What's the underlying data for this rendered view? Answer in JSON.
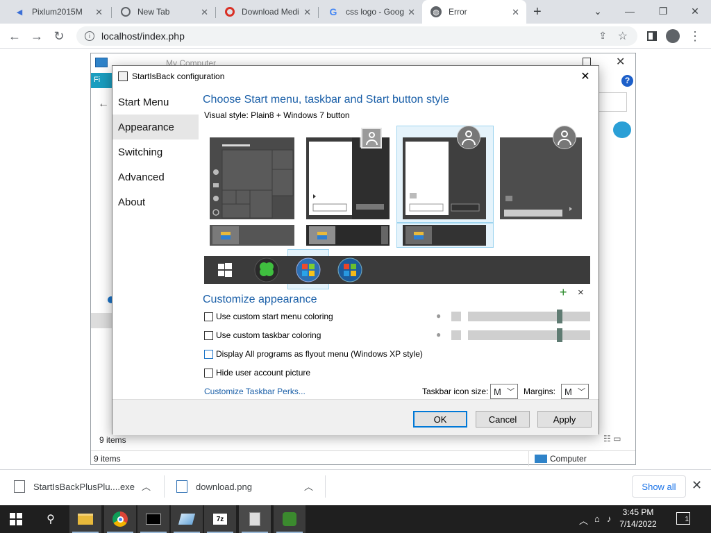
{
  "browser": {
    "tabs": [
      {
        "title": "Pixlum2015M",
        "active": false
      },
      {
        "title": "New Tab",
        "active": false
      },
      {
        "title": "Download Medi",
        "active": false
      },
      {
        "title": "css logo - Goog",
        "active": false
      },
      {
        "title": "Error",
        "active": true
      }
    ],
    "new_tab_symbol": "+",
    "url": "localhost/index.php"
  },
  "explorer": {
    "title": "My Computer",
    "ribbon_tab": "Fi",
    "items_count_top": "9 items",
    "items_count_status": "9 items",
    "status_location": "Computer"
  },
  "dialog": {
    "title": "StartIsBack configuration",
    "nav": [
      {
        "label": "Start Menu",
        "selected": false
      },
      {
        "label": "Appearance",
        "selected": true
      },
      {
        "label": "Switching",
        "selected": false
      },
      {
        "label": "Advanced",
        "selected": false
      },
      {
        "label": "About",
        "selected": false
      }
    ],
    "heading_style": "Choose Start menu, taskbar and Start button style",
    "visual_style": "Visual style:  Plain8 + Windows 7 button",
    "heading_customize": "Customize appearance",
    "options": [
      {
        "label": "Use custom start menu coloring",
        "checked": false
      },
      {
        "label": "Use custom taskbar coloring",
        "checked": false
      },
      {
        "label": "Display All programs as flyout menu (Windows XP style)",
        "checked": false
      },
      {
        "label": "Hide user account picture",
        "checked": false
      }
    ],
    "start_menu_slider_level": 0.76,
    "taskbar_slider_level": 0.76,
    "add_symbol": "+",
    "remove_symbol": "×",
    "perks_link": "Customize Taskbar Perks...",
    "taskbar_icon_size_label": "Taskbar icon size:",
    "taskbar_icon_size_value": "M",
    "margins_label": "Margins:",
    "margins_value": "M",
    "buttons": {
      "ok": "OK",
      "cancel": "Cancel",
      "apply": "Apply"
    }
  },
  "downloads": {
    "items": [
      {
        "name": "StartIsBackPlusPlu....exe"
      },
      {
        "name": "download.png"
      }
    ],
    "show_all": "Show all"
  },
  "taskbar": {
    "time": "3:45 PM",
    "date": "7/14/2022",
    "notification_count": "1"
  }
}
